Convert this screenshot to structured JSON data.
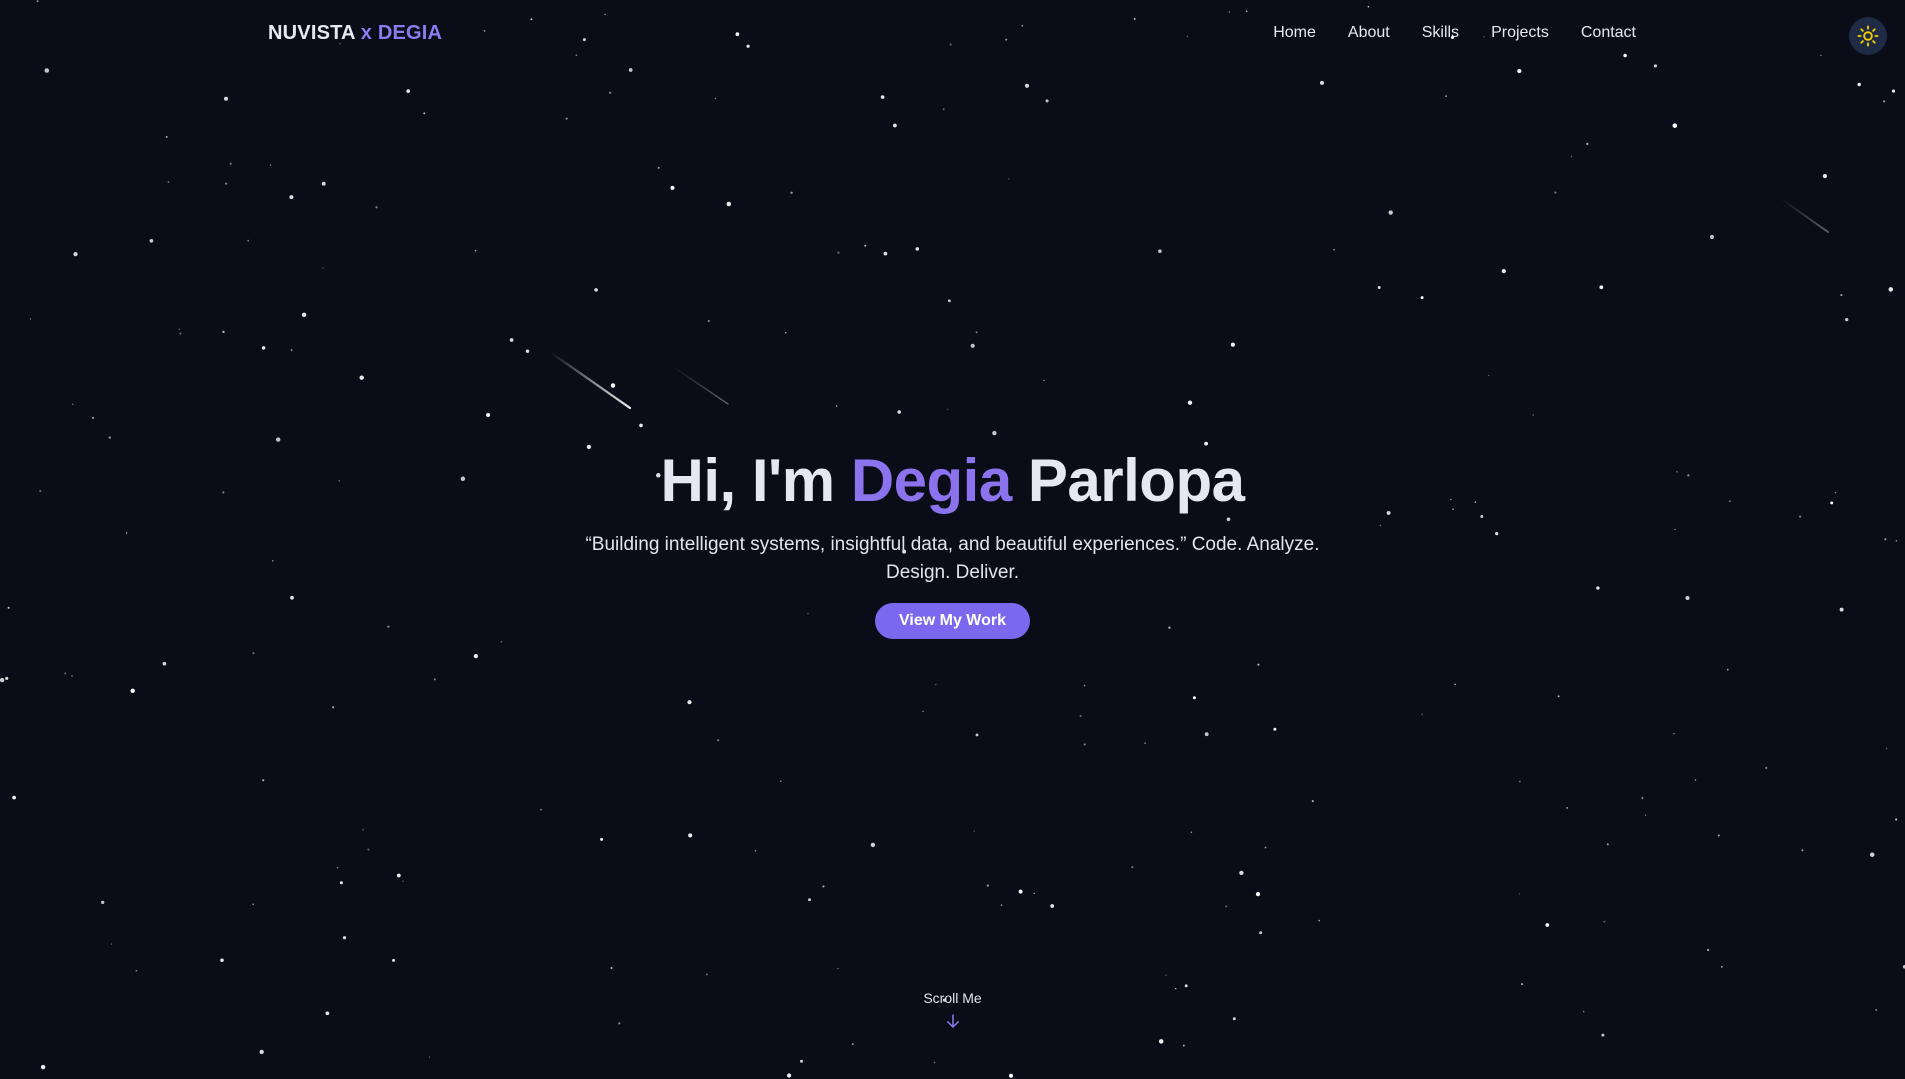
{
  "header": {
    "logo_primary": "NUVISTA",
    "logo_accent": "x DEGIA",
    "nav": [
      {
        "label": "Home"
      },
      {
        "label": "About"
      },
      {
        "label": "Skills"
      },
      {
        "label": "Projects"
      },
      {
        "label": "Contact"
      }
    ],
    "theme_icon": "sun-icon"
  },
  "hero": {
    "greeting": "Hi, I'm",
    "first_name": "Degia",
    "last_name": "Parlopa",
    "tagline": "“Building intelligent systems, insightful data, and beautiful experiences.” Code. Analyze. Design. Deliver.",
    "cta_label": "View My Work"
  },
  "scroll": {
    "label": "Scroll Me",
    "icon": "arrow-down-icon"
  },
  "colors": {
    "background": "#0a0c17",
    "accent": "#8b73ee",
    "button": "#7b68ee",
    "toggle_bg": "#1f2a44",
    "sun": "#f5d000"
  }
}
